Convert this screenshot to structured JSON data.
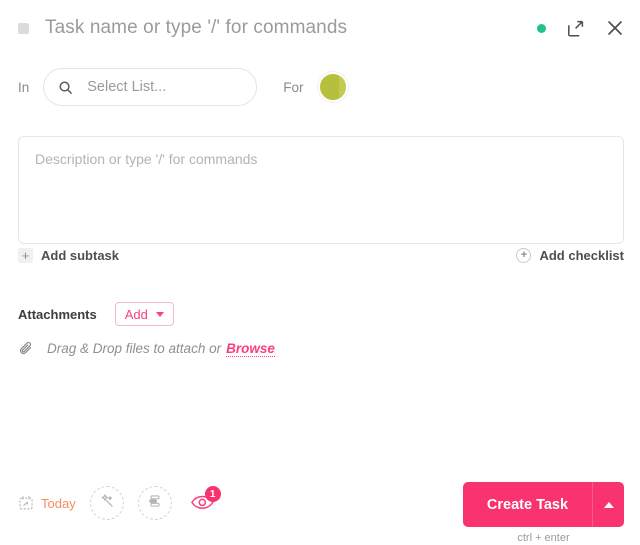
{
  "header": {
    "title_placeholder": "Task name or type '/' for commands",
    "type_indicator": "task-type-square",
    "status_dot_color": "#1ec28b",
    "expand_label": "Open full view",
    "close_label": "Close"
  },
  "meta": {
    "in_label": "In",
    "list_placeholder": "Select List...",
    "for_label": "For",
    "assignee_color": "#b7c03c"
  },
  "description": {
    "placeholder": "Description or type '/' for commands"
  },
  "sub_actions": {
    "add_subtask": "Add subtask",
    "add_checklist": "Add checklist",
    "plus": "+"
  },
  "attachments": {
    "title": "Attachments",
    "add_label": "Add",
    "dropzone_text": "Drag & Drop files to attach or",
    "browse_label": "Browse"
  },
  "footer": {
    "date_label": "Today",
    "date_color": "#f98c62",
    "automation_label": "AI / magic actions",
    "priority_label": "Set priority",
    "watchers_label": "Watchers",
    "watchers_count": "1",
    "create_label": "Create Task",
    "shortcut_hint": "ctrl + enter",
    "accent_color": "#f8336f"
  }
}
